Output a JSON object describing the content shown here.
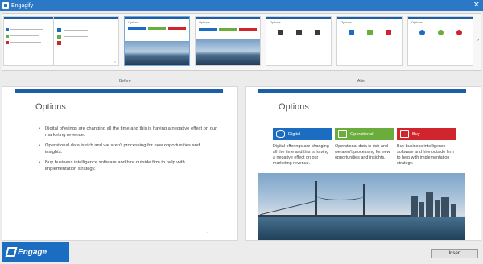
{
  "window": {
    "title": "Engagify",
    "close_glyph": "✕"
  },
  "thumbnails": [
    {
      "title": "",
      "page": "1"
    },
    {
      "title": "",
      "page": "2"
    },
    {
      "title": "Options",
      "page": "3",
      "selected": true
    },
    {
      "title": "Options",
      "page": "4"
    },
    {
      "title": "Options",
      "page": "5"
    },
    {
      "title": "Options",
      "page": "6"
    },
    {
      "title": "Options",
      "page": "7"
    }
  ],
  "compare": {
    "before_label": "Before",
    "after_label": "After"
  },
  "before_slide": {
    "title": "Options",
    "bullets": [
      "Digital offerings are changing all the time and this is having a negative effect on our marketing revenue.",
      "Operational data is rich and we aren't processing for new opportunities and insights.",
      "Buy business intelligence software and hire outside firm to help with implementation strategy."
    ],
    "page": "1"
  },
  "after_slide": {
    "title": "Options",
    "options": [
      {
        "label": "Digital",
        "icon": "database-icon",
        "color": "#1b6dc1",
        "text": "Digital offerings are changing all the time and this is having a negative effect on our marketing revenue."
      },
      {
        "label": "Operational",
        "icon": "monitor-icon",
        "color": "#6aad3d",
        "text": "Operational data is rich and we aren't processing for new opportunities and insights."
      },
      {
        "label": "Buy",
        "icon": "cart-icon",
        "color": "#d0252d",
        "text": "Buy business intelligence software and hire outside firm to help with implementation strategy."
      }
    ],
    "page": "1"
  },
  "footer": {
    "logo_text": "Engage",
    "insert_label": "Insert"
  },
  "colors": {
    "titlebar": "#2b79c6",
    "accent": "#1b5fa8",
    "green": "#6aad3d",
    "red": "#d0252d"
  }
}
